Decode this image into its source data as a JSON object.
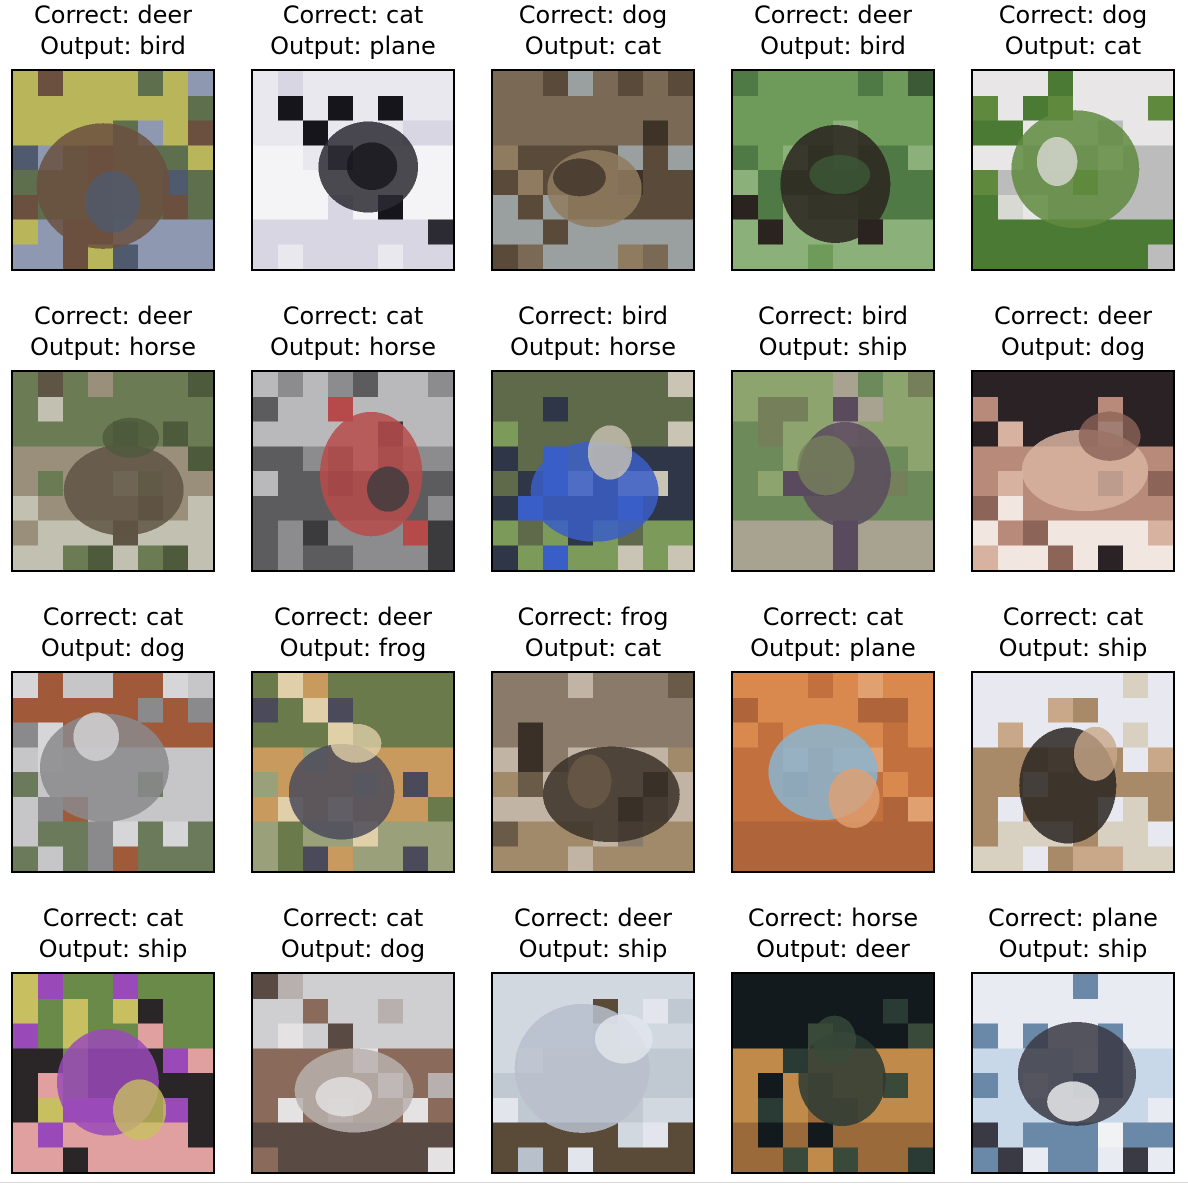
{
  "figure": {
    "correct_prefix": "Correct:",
    "output_prefix": "Output:"
  },
  "cells": [
    {
      "correct": "deer",
      "output": "bird",
      "image": "deer-in-water",
      "colors": [
        "#b9b55a",
        "#5e6f4e",
        "#6b5040",
        "#8e98b0",
        "#4f5a6e"
      ]
    },
    {
      "correct": "cat",
      "output": "plane",
      "image": "black-white-cat",
      "colors": [
        "#e9e8ee",
        "#f4f4f6",
        "#2c2a33",
        "#d8d6e2",
        "#16151c"
      ]
    },
    {
      "correct": "dog",
      "output": "cat",
      "image": "dog-face-closeup",
      "colors": [
        "#7a6a55",
        "#5a4a3a",
        "#8f7b5f",
        "#9aa0a0",
        "#3f3328"
      ]
    },
    {
      "correct": "deer",
      "output": "bird",
      "image": "dark-deer-grass",
      "colors": [
        "#6e9a5a",
        "#4f7a45",
        "#2a2320",
        "#8cb07a",
        "#3c5a36"
      ]
    },
    {
      "correct": "dog",
      "output": "cat",
      "image": "white-dog-on-grass",
      "colors": [
        "#e8e6e6",
        "#bcbcbc",
        "#5f8a3e",
        "#4a7a34",
        "#d9d9d4"
      ]
    },
    {
      "correct": "deer",
      "output": "horse",
      "image": "deer-in-field",
      "colors": [
        "#6b7c55",
        "#9a8f7a",
        "#5f5544",
        "#c2c0b0",
        "#4e5a3c"
      ]
    },
    {
      "correct": "cat",
      "output": "horse",
      "image": "cat-lying-red-bowl",
      "colors": [
        "#b9b9bb",
        "#5c5c5e",
        "#b64a4a",
        "#8c8c8e",
        "#3b3b3d"
      ]
    },
    {
      "correct": "bird",
      "output": "horse",
      "image": "blue-bird-leaves",
      "colors": [
        "#5e6a4a",
        "#2f3648",
        "#3a5ec8",
        "#7c9a5a",
        "#c9c4b4"
      ]
    },
    {
      "correct": "bird",
      "output": "ship",
      "image": "bird-on-branch",
      "colors": [
        "#8ea46e",
        "#6c8a5a",
        "#5a4a5e",
        "#a8a290",
        "#75805a"
      ]
    },
    {
      "correct": "deer",
      "output": "dog",
      "image": "deer-face-closeup",
      "colors": [
        "#2a2224",
        "#b88a7a",
        "#d7b2a0",
        "#f2e6e0",
        "#8c6458"
      ]
    },
    {
      "correct": "cat",
      "output": "dog",
      "image": "grey-cat-on-floor",
      "colors": [
        "#a05a3a",
        "#c6c6c8",
        "#8a8a8c",
        "#6a7a5a",
        "#d6d6d8"
      ]
    },
    {
      "correct": "deer",
      "output": "frog",
      "image": "deer-with-people",
      "colors": [
        "#6a7a4a",
        "#c99a5e",
        "#4a4a5a",
        "#9aa07a",
        "#e0cfa8"
      ]
    },
    {
      "correct": "frog",
      "output": "cat",
      "image": "camouflaged-frog",
      "colors": [
        "#8a7a6a",
        "#c2b4a4",
        "#3a3028",
        "#a08a6a",
        "#6a5a48"
      ]
    },
    {
      "correct": "cat",
      "output": "plane",
      "image": "painted-blue-cat",
      "colors": [
        "#d9894e",
        "#c2703e",
        "#8ab4d0",
        "#b0643a",
        "#e0a070"
      ]
    },
    {
      "correct": "cat",
      "output": "ship",
      "image": "cat-with-frame",
      "colors": [
        "#e8e8f0",
        "#a88a68",
        "#2a2622",
        "#d8d0c0",
        "#c8a888"
      ]
    },
    {
      "correct": "cat",
      "output": "ship",
      "image": "black-cat-held",
      "colors": [
        "#6a8a4a",
        "#2a2628",
        "#9a4ab8",
        "#e0a0a0",
        "#c8c060"
      ]
    },
    {
      "correct": "cat",
      "output": "dog",
      "image": "kitten-in-hands",
      "colors": [
        "#cfcfd2",
        "#8a6a5a",
        "#b8b0ae",
        "#5a4a44",
        "#e4e2e2"
      ]
    },
    {
      "correct": "deer",
      "output": "ship",
      "image": "deer-in-snow",
      "colors": [
        "#d2d8e0",
        "#c0c8d2",
        "#b8c0cc",
        "#5a4a38",
        "#e2e6ec"
      ]
    },
    {
      "correct": "horse",
      "output": "deer",
      "image": "horse-at-night",
      "colors": [
        "#121a1e",
        "#c08a4a",
        "#2a3a34",
        "#9a6a3a",
        "#3a4a3a"
      ]
    },
    {
      "correct": "plane",
      "output": "ship",
      "image": "plane-in-sky",
      "colors": [
        "#e8ecf2",
        "#c8d8e8",
        "#3a3a44",
        "#6a88a8",
        "#f0f2f4"
      ]
    }
  ]
}
